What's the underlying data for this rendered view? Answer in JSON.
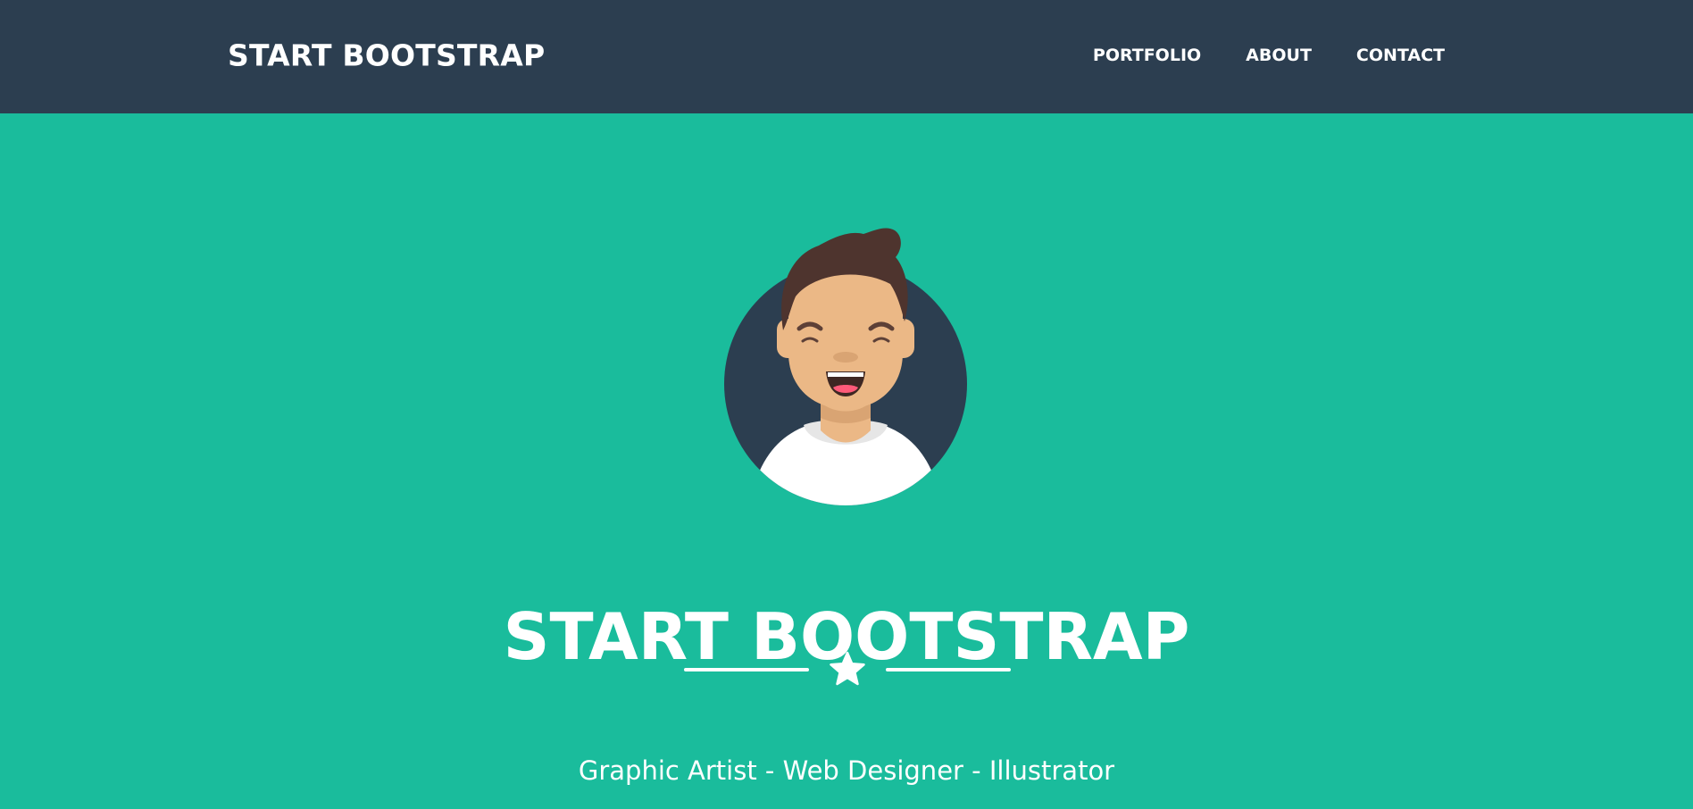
{
  "navbar": {
    "brand": "START BOOTSTRAP",
    "links": [
      "PORTFOLIO",
      "ABOUT",
      "CONTACT"
    ]
  },
  "masthead": {
    "avatar_icon": "avatar-icon",
    "title": "START BOOTSTRAP",
    "divider_icon": "star-icon",
    "subtitle": "Graphic Artist - Web Designer - Illustrator"
  },
  "colors": {
    "navbar": "#2c3e50",
    "masthead": "#1abc9c",
    "text": "#ffffff"
  }
}
